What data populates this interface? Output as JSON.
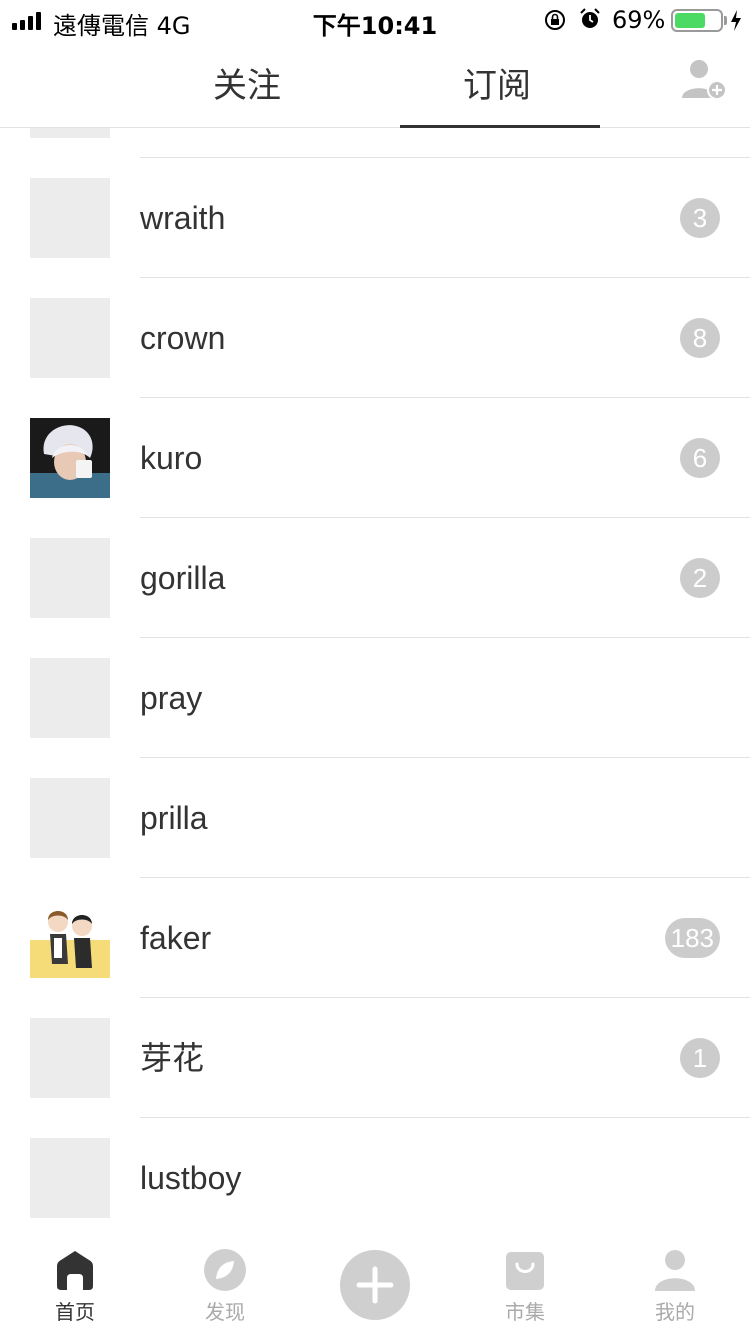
{
  "status_bar": {
    "carrier": "遠傳電信  4G",
    "time": "下午10:41",
    "battery_percent": "69%",
    "battery_level": 0.69
  },
  "header": {
    "tabs": [
      {
        "label": "关注",
        "active": false
      },
      {
        "label": "订阅",
        "active": true
      }
    ]
  },
  "subscriptions": [
    {
      "name": "wraith",
      "badge": "3"
    },
    {
      "name": "crown",
      "badge": "8"
    },
    {
      "name": "kuro",
      "badge": "6"
    },
    {
      "name": "gorilla",
      "badge": "2"
    },
    {
      "name": "pray",
      "badge": ""
    },
    {
      "name": "prilla",
      "badge": ""
    },
    {
      "name": "faker",
      "badge": "183"
    },
    {
      "name": "芽花",
      "badge": "1"
    },
    {
      "name": "lustboy",
      "badge": ""
    }
  ],
  "tabbar": {
    "items": [
      {
        "label": "首页",
        "icon": "home-icon",
        "active": true
      },
      {
        "label": "发现",
        "icon": "discover-icon",
        "active": false
      },
      {
        "label": "",
        "icon": "plus-icon",
        "active": false
      },
      {
        "label": "市集",
        "icon": "bag-icon",
        "active": false
      },
      {
        "label": "我的",
        "icon": "profile-icon",
        "active": false
      }
    ]
  },
  "colors": {
    "badge": "#cccccc",
    "avatar_placeholder": "#ececec",
    "battery": "#4cd964",
    "tabbar_inactive": "#aaaaaa"
  }
}
